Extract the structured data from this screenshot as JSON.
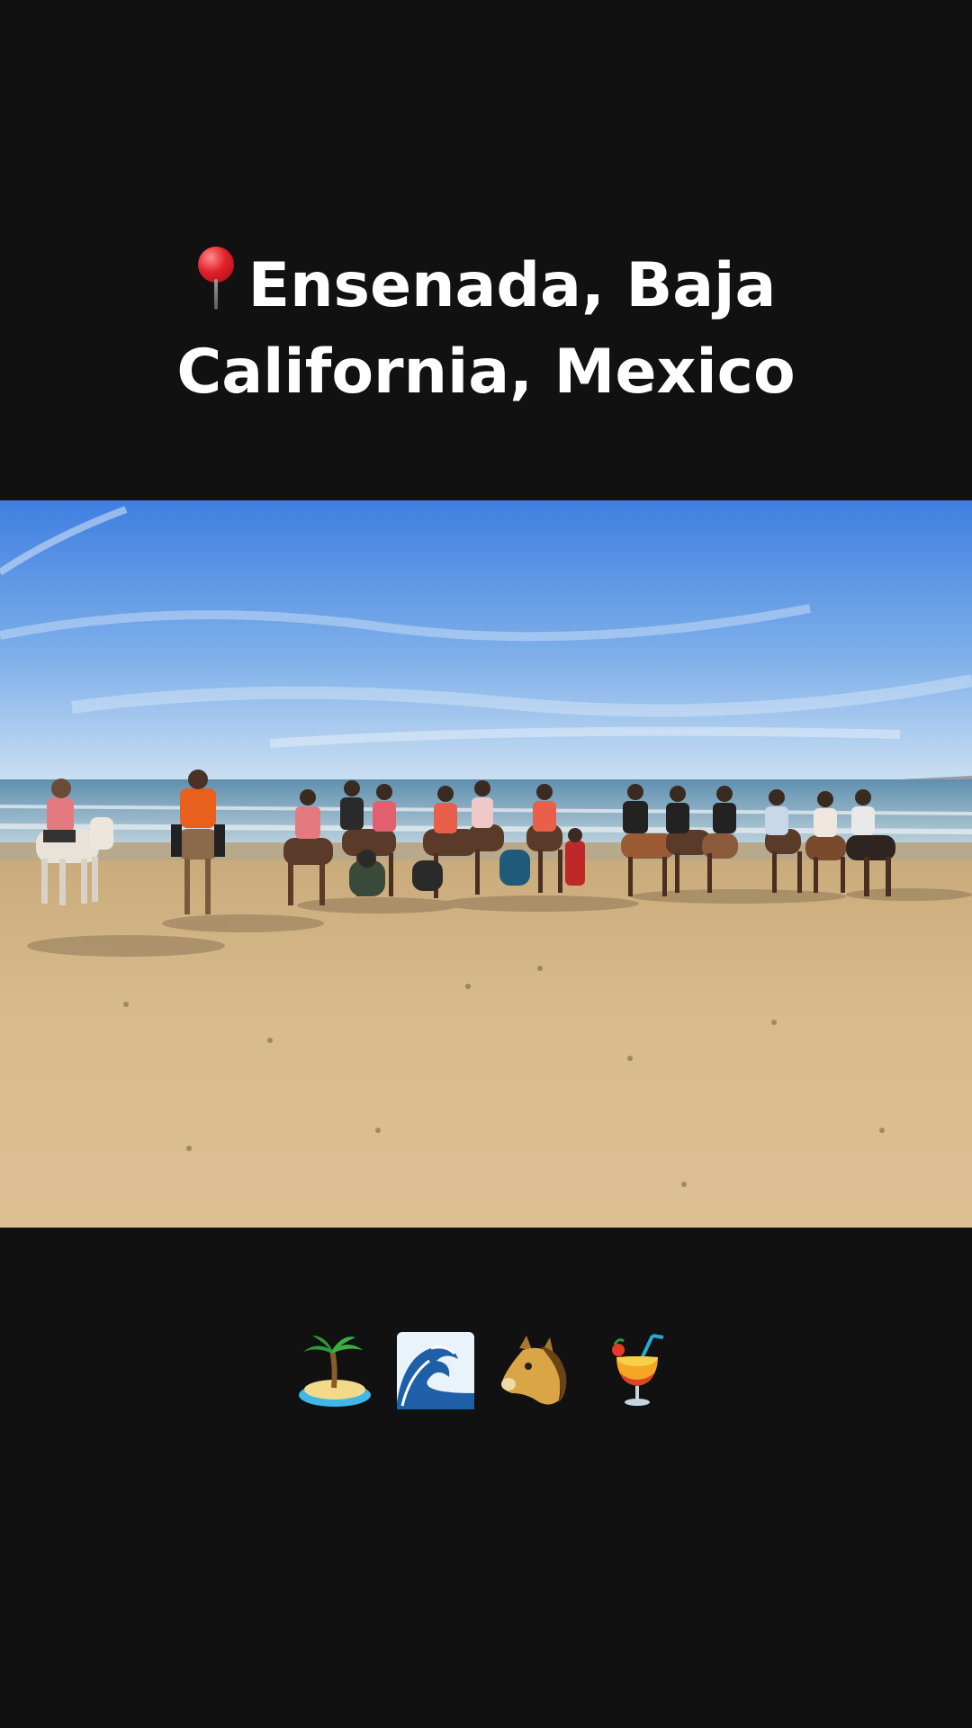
{
  "caption": {
    "pin_icon": "round-pushpin-icon",
    "line1": "Ensenada, Baja",
    "line2": "California, Mexico"
  },
  "photo": {
    "subject": "group-on-horseback-at-beach"
  },
  "emojis": [
    {
      "icon": "desert-island-icon"
    },
    {
      "icon": "water-wave-icon"
    },
    {
      "icon": "horse-face-icon"
    },
    {
      "icon": "tropical-drink-icon"
    }
  ],
  "colors": {
    "background": "#111111",
    "text": "#ffffff",
    "sky_top": "#3f7fe0",
    "sand": "#d8bb8c"
  }
}
